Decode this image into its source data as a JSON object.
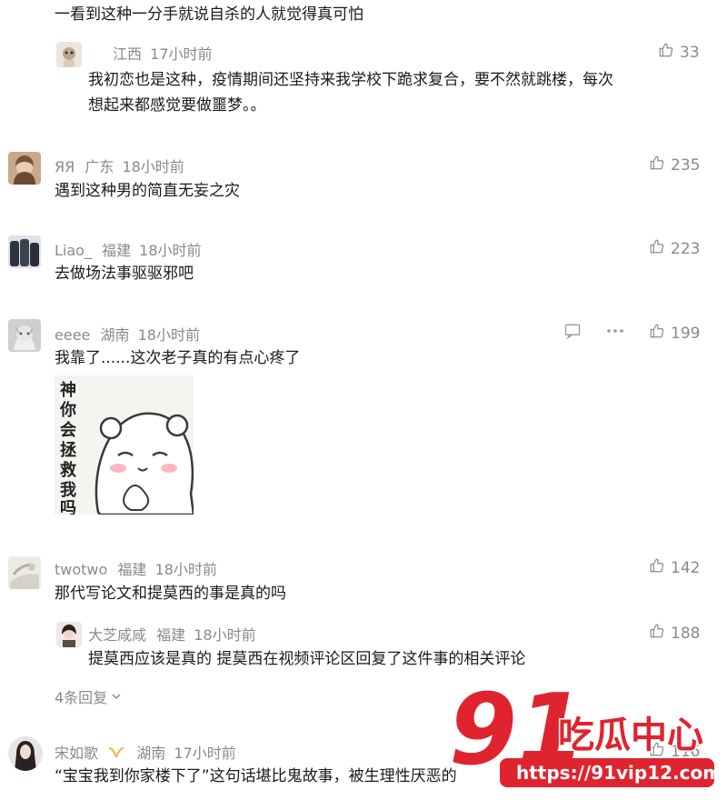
{
  "comments": [
    {
      "id": "c0",
      "text": "一看到这种一分手就说自杀的人就觉得真可怕"
    },
    {
      "id": "r0",
      "location": "江西",
      "time": "17小时前",
      "likes": "33",
      "text_line1": "我初恋也是这种，疫情期间还坚持来我学校下跪求复合，要不然就跳楼，每次",
      "text_line2": "想起来都感觉要做噩梦。。"
    },
    {
      "id": "c1",
      "user": "ЯЯ",
      "location": "广东",
      "time": "18小时前",
      "likes": "235",
      "text": "遇到这种男的简直无妄之灾"
    },
    {
      "id": "c2",
      "user": "Liao_",
      "location": "福建",
      "time": "18小时前",
      "likes": "223",
      "text": "去做场法事驱驱邪吧"
    },
    {
      "id": "c3",
      "user": "eeee",
      "location": "湖南",
      "time": "18小时前",
      "likes": "199",
      "text": "我靠了......这次老子真的有点心疼了",
      "sticker_text": [
        "神",
        "你",
        "会",
        "拯",
        "救",
        "我",
        "吗"
      ]
    },
    {
      "id": "c4",
      "user": "twotwo",
      "location": "福建",
      "time": "18小时前",
      "likes": "142",
      "text": "那代写论文和提莫西的事是真的吗"
    },
    {
      "id": "r4",
      "user": "大芝咸咸",
      "location": "福建",
      "time": "18小时前",
      "likes": "188",
      "text": "提莫西应该是真的 提莫西在视频评论区回复了这件事的相关评论"
    },
    {
      "id": "c5",
      "user": "宋如歌",
      "location": "湖南",
      "time": "17小时前",
      "likes": "116",
      "text": "“宝宝我到你家楼下了”这句话堪比鬼故事，被生理性厌恶的"
    }
  ],
  "more_replies": "4条回复",
  "watermark": {
    "big": "91",
    "brand": "吃瓜中心",
    "url": "https://91vip12.com"
  },
  "colors": {
    "meta_gray": "#8a8a8a",
    "watermark_red": "#e0242f",
    "text": "#1a1a1a"
  }
}
